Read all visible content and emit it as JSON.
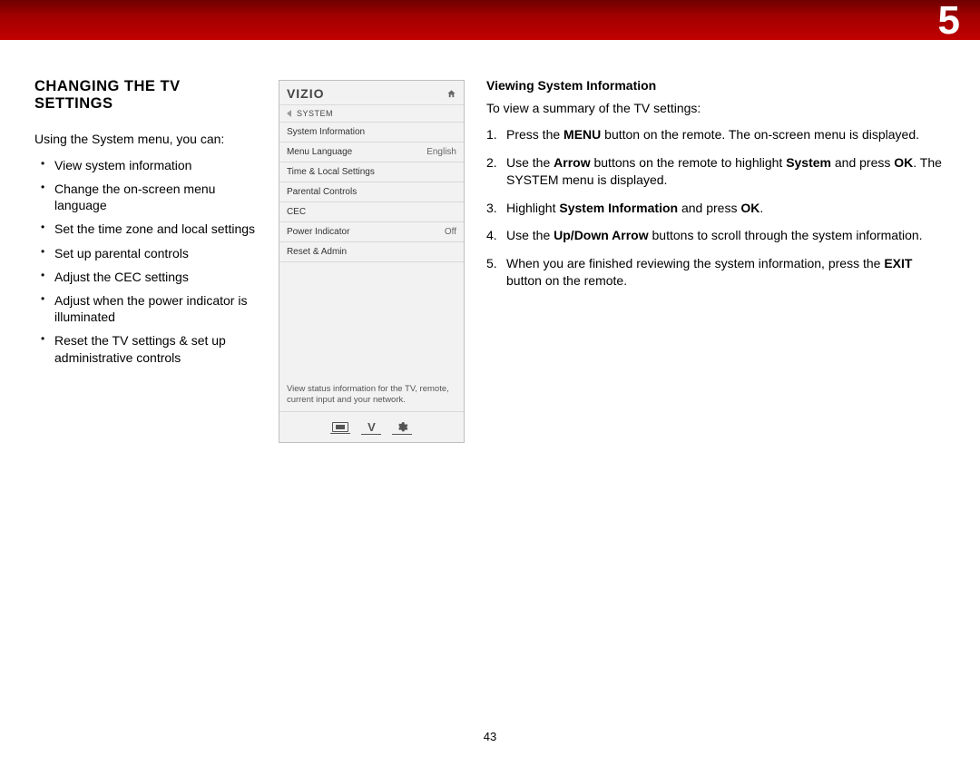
{
  "chapter_number": "5",
  "page_number": "43",
  "left": {
    "heading": "CHANGING THE TV SETTINGS",
    "intro": "Using the System menu, you can:",
    "bullets": [
      "View system information",
      "Change the on-screen menu language",
      "Set the time zone and local settings",
      "Set up parental controls",
      "Adjust the CEC settings",
      "Adjust when the power indicator is illuminated",
      "Reset the TV settings & set up administrative controls"
    ]
  },
  "tv_panel": {
    "brand": "VIZIO",
    "breadcrumb": "SYSTEM",
    "rows": [
      {
        "label": "System Information",
        "value": ""
      },
      {
        "label": "Menu Language",
        "value": "English"
      },
      {
        "label": "Time & Local Settings",
        "value": ""
      },
      {
        "label": "Parental Controls",
        "value": ""
      },
      {
        "label": "CEC",
        "value": ""
      },
      {
        "label": "Power Indicator",
        "value": "Off"
      },
      {
        "label": "Reset & Admin",
        "value": ""
      }
    ],
    "help_text": "View status information for the TV, remote, current input and your network."
  },
  "right": {
    "subheading": "Viewing System Information",
    "intro": "To view a summary of the TV settings:",
    "steps": [
      {
        "pre": "Press the ",
        "b1": "MENU",
        "post": " button on the remote. The on-screen menu is displayed."
      },
      {
        "pre": "Use the ",
        "b1": "Arrow",
        "mid": " buttons on the remote to highlight ",
        "b2": "System",
        "mid2": " and press ",
        "b3": "OK",
        "post": ". The SYSTEM menu is displayed."
      },
      {
        "pre": "Highlight ",
        "b1": "System Information",
        "mid": " and press ",
        "b2": "OK",
        "post": "."
      },
      {
        "pre": "Use the ",
        "b1": "Up/Down Arrow",
        "post": " buttons to scroll through the system information."
      },
      {
        "pre": "When you are finished reviewing the system information, press the ",
        "b1": "EXIT",
        "post": " button on the remote."
      }
    ]
  }
}
